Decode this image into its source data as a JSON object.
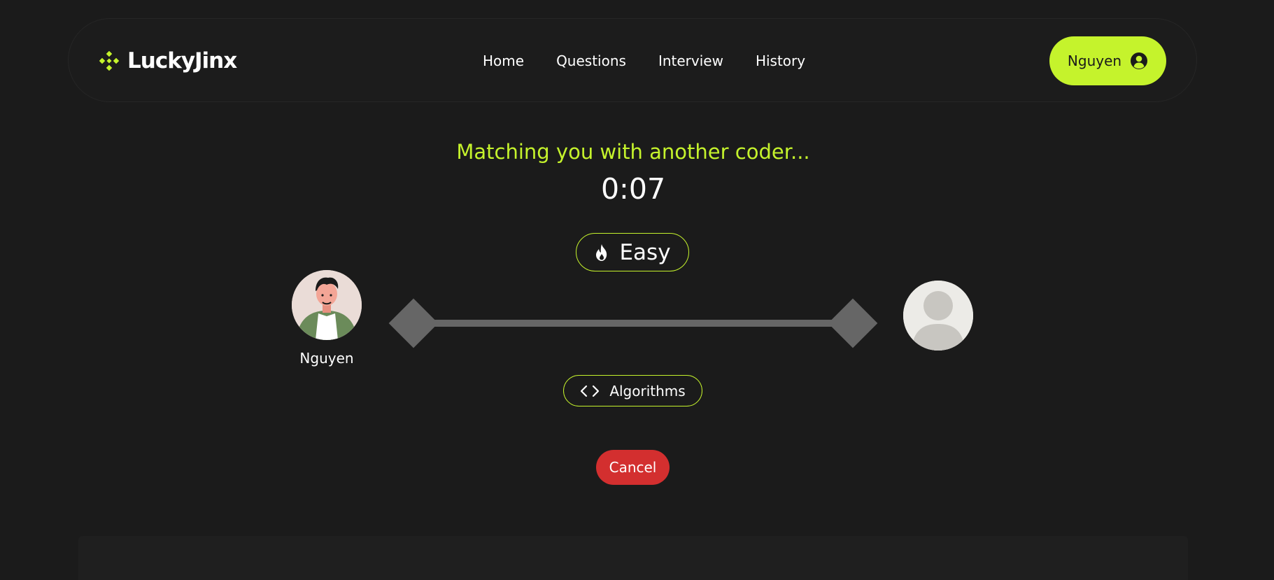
{
  "header": {
    "logo_text": "LuckyJinx",
    "nav": [
      {
        "label": "Home"
      },
      {
        "label": "Questions"
      },
      {
        "label": "Interview"
      },
      {
        "label": "History"
      }
    ],
    "user": {
      "name": "Nguyen",
      "icon": "user-circle-icon"
    }
  },
  "matching": {
    "status": "Matching you with another coder...",
    "timer": "0:07",
    "difficulty": {
      "label": "Easy",
      "icon": "fire-icon"
    },
    "topic": {
      "label": "Algorithms",
      "icon": "code-brackets-icon"
    },
    "player": {
      "name": "Nguyen"
    },
    "cancel_label": "Cancel"
  },
  "colors": {
    "accent": "#c5f32c",
    "background": "#1b1b1b",
    "cancel": "#d32f2f",
    "connector": "#666666"
  }
}
